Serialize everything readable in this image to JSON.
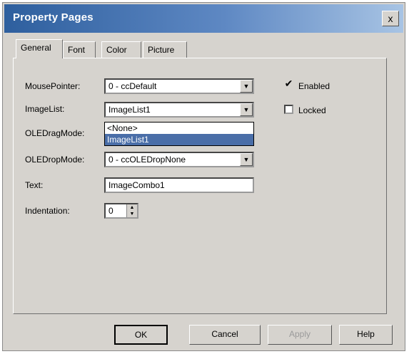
{
  "window": {
    "title": "Property Pages",
    "close_glyph": "x"
  },
  "tabs": [
    {
      "label": "General",
      "active": true
    },
    {
      "label": "Font",
      "active": false
    },
    {
      "label": "Color",
      "active": false
    },
    {
      "label": "Picture",
      "active": false
    }
  ],
  "fields": {
    "mouse_pointer": {
      "label": "MousePointer:",
      "value": "0 - ccDefault"
    },
    "image_list": {
      "label": "ImageList:",
      "value": "ImageList1"
    },
    "ole_drag_mode": {
      "label": "OLEDragMode:"
    },
    "ole_drop_mode": {
      "label": "OLEDropMode:",
      "value": "0 - ccOLEDropNone"
    },
    "text": {
      "label": "Text:",
      "value": "ImageCombo1"
    },
    "indentation": {
      "label": "Indentation:",
      "value": "0"
    }
  },
  "dropdown": {
    "options": [
      "<None>",
      "ImageList1"
    ],
    "selected": "ImageList1"
  },
  "checkboxes": {
    "enabled": {
      "label": "Enabled",
      "checked": true
    },
    "locked": {
      "label": "Locked",
      "checked": false
    }
  },
  "buttons": {
    "ok": "OK",
    "cancel": "Cancel",
    "apply": "Apply",
    "help": "Help"
  }
}
